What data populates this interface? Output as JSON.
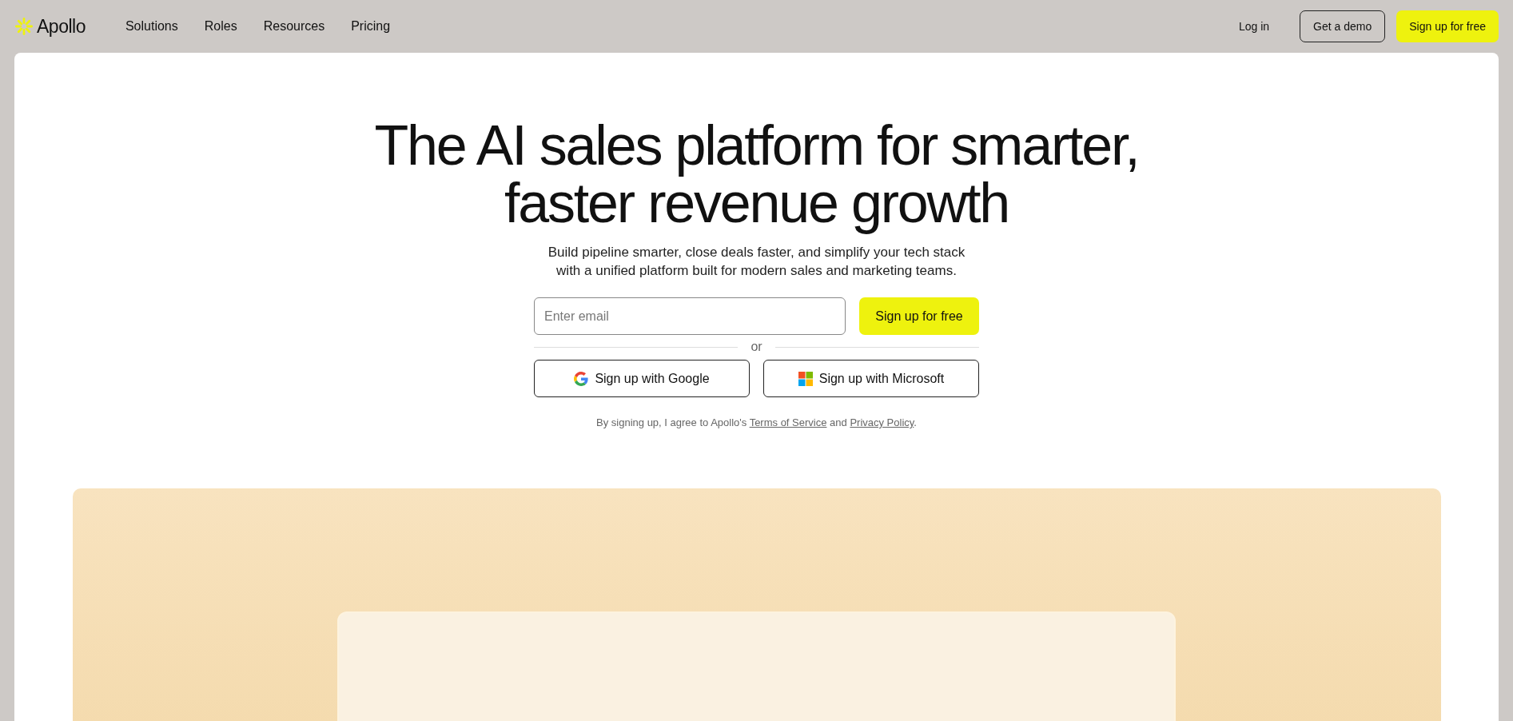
{
  "nav": {
    "logo": "Apollo",
    "links": [
      "Solutions",
      "Roles",
      "Resources",
      "Pricing"
    ],
    "login": "Log in",
    "demo": "Get a demo",
    "signup": "Sign up for free"
  },
  "hero": {
    "headline": [
      "The AI sales platform for smarter,",
      "faster revenue growth"
    ],
    "subtitle": [
      "Build pipeline smarter, close deals faster, and simplify your tech stack",
      "with a unified platform built for modern sales and marketing teams."
    ],
    "email": {
      "placeholder": "Enter email"
    },
    "signup": "Sign up for free",
    "divider": "or",
    "social": [
      {
        "kind": "google",
        "label": "Sign up with Google"
      },
      {
        "kind": "microsoft",
        "label": "Sign up with Microsoft"
      }
    ],
    "legal": {
      "prefix": "By signing up, I agree to Apollo's",
      "terms": "Terms of Service",
      "middle": "and",
      "privacy": "Privacy Policy",
      "suffix": "."
    }
  }
}
